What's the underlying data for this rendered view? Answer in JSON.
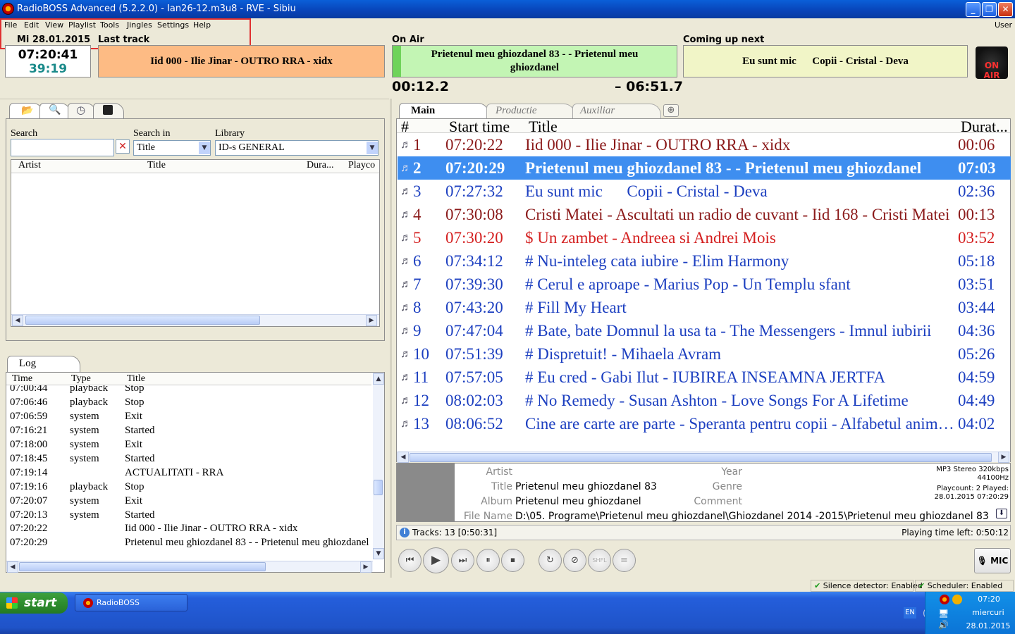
{
  "window": {
    "title": "RadioBOSS Advanced (5.2.2.0) - Ian26-12.m3u8 - RVE - Sibiu",
    "min": "_",
    "max": "❐",
    "close": "✕"
  },
  "menu": [
    "File",
    "Edit",
    "View",
    "Playlist",
    "Tools",
    "Jingles",
    "Settings",
    "Help"
  ],
  "menu_user": "User",
  "clock": {
    "date": "Mi 28.01.2015",
    "time": "07:20:41",
    "remaining": "39:19"
  },
  "last_track": {
    "label": "Last track",
    "text": "Iid 000 - Ilie Jinar - OUTRO RRA - xidx",
    "color": "#fdbb84"
  },
  "on_air": {
    "label": "On Air",
    "text": "Prietenul meu ghiozdanel 83 -  - Prietenul meu ghiozdanel",
    "elapsed": "00:12.2",
    "remaining": "– 06:51.7",
    "color": "#c3f5b4",
    "progress": 0.03
  },
  "coming_next": {
    "label": "Coming up next",
    "text": "Eu sunt mic      Copii - Cristal - Deva",
    "color": "#f1f5c7"
  },
  "onair_logo": {
    "text": "ON AIR"
  },
  "search": {
    "search_label": "Search",
    "searchin_label": "Search in",
    "searchin_value": "Title",
    "library_label": "Library",
    "library_value": "ID-s GENERAL",
    "columns": [
      "Artist",
      "Title",
      "Dura...",
      "Playco"
    ]
  },
  "log": {
    "tab": "Log",
    "columns": [
      "Time",
      "Type",
      "Title"
    ],
    "rows": [
      [
        "07:00:44",
        "playback",
        "Stop"
      ],
      [
        "07:06:46",
        "playback",
        "Stop"
      ],
      [
        "07:06:59",
        "system",
        "Exit"
      ],
      [
        "07:16:21",
        "system",
        "Started"
      ],
      [
        "07:18:00",
        "system",
        "Exit"
      ],
      [
        "07:18:45",
        "system",
        "Started"
      ],
      [
        "07:19:14",
        "",
        "ACTUALITATI - RRA"
      ],
      [
        "07:19:16",
        "playback",
        "Stop"
      ],
      [
        "07:20:07",
        "system",
        "Exit"
      ],
      [
        "07:20:13",
        "system",
        "Started"
      ],
      [
        "07:20:22",
        "",
        "Iid 000 - Ilie Jinar - OUTRO RRA - xidx"
      ],
      [
        "07:20:29",
        "",
        "Prietenul meu ghiozdanel 83 -  - Prietenul meu ghiozdanel"
      ]
    ]
  },
  "playlist_tabs": [
    "Main",
    "Productie",
    "Auxiliar"
  ],
  "playlist": {
    "columns": [
      "#",
      "Start time",
      "Title",
      "Durat..."
    ],
    "rows": [
      {
        "n": "1",
        "start": "07:20:22",
        "title": "Iid 000 - Ilie Jinar - OUTRO RRA - xidx",
        "dur": "00:06",
        "color": "#8b1a1a"
      },
      {
        "n": "2",
        "start": "07:20:29",
        "title": "Prietenul meu ghiozdanel 83 -  - Prietenul meu ghiozdanel",
        "dur": "07:03",
        "color": "#ffffff"
      },
      {
        "n": "3",
        "start": "07:27:32",
        "title": "Eu sunt mic      Copii - Cristal - Deva",
        "dur": "02:36",
        "color": "#1c3fc0"
      },
      {
        "n": "4",
        "start": "07:30:08",
        "title": "Cristi Matei - Ascultati un radio de cuvant - Iid 168 - Cristi Matei",
        "dur": "00:13",
        "color": "#8b1a1a"
      },
      {
        "n": "5",
        "start": "07:30:20",
        "title": "$ Un zambet - Andreea si Andrei Mois",
        "dur": "03:52",
        "color": "#d42020"
      },
      {
        "n": "6",
        "start": "07:34:12",
        "title": "# Nu-inteleg cata iubire - Elim Harmony",
        "dur": "05:18",
        "color": "#1c3fc0"
      },
      {
        "n": "7",
        "start": "07:39:30",
        "title": "# Cerul e aproape - Marius Pop - Un Templu sfant",
        "dur": "03:51",
        "color": "#1c3fc0"
      },
      {
        "n": "8",
        "start": "07:43:20",
        "title": "# Fill My Heart",
        "dur": "03:44",
        "color": "#1c3fc0"
      },
      {
        "n": "9",
        "start": "07:47:04",
        "title": "# Bate, bate Domnul la usa ta - The Messengers - Imnul iubirii",
        "dur": "04:36",
        "color": "#1c3fc0"
      },
      {
        "n": "10",
        "start": "07:51:39",
        "title": "# Dispretuit! - Mihaela Avram",
        "dur": "05:26",
        "color": "#1c3fc0"
      },
      {
        "n": "11",
        "start": "07:57:05",
        "title": "# Eu cred - Gabi Ilut - IUBIREA INSEAMNA JERTFA",
        "dur": "04:59",
        "color": "#1c3fc0"
      },
      {
        "n": "12",
        "start": "08:02:03",
        "title": "# No Remedy - Susan Ashton - Love Songs For A Lifetime",
        "dur": "04:49",
        "color": "#1c3fc0"
      },
      {
        "n": "13",
        "start": "08:06:52",
        "title": "Cine are carte are parte - Speranta pentru copii - Alfabetul animalelor",
        "dur": "04:02",
        "color": "#1c3fc0"
      }
    ]
  },
  "track_info": {
    "artist_label": "Artist",
    "title_label": "Title",
    "album_label": "Album",
    "filename_label": "File Name",
    "year_label": "Year",
    "genre_label": "Genre",
    "comment_label": "Comment",
    "title": "Prietenul meu ghiozdanel 83",
    "album": "Prietenul meu ghiozdanel",
    "filename": "D:\\05. Programe\\Prietenul meu ghiozdanel\\Ghiozdanel 2014 -2015\\Prietenul meu ghiozdanel 83",
    "format": "MP3 Stereo 320kbps",
    "rate": "44100Hz",
    "playcount": "Playcount: 2  Played:",
    "played": "28.01.2015 07:20:29"
  },
  "status": {
    "tracks": "Tracks: 13 [0:50:31]",
    "time_left": "Playing time left: 0:50:12"
  },
  "mic": "MIC",
  "bottom_status": {
    "silence": "Silence detector: Enabled",
    "scheduler": "Scheduler: Enabled"
  },
  "taskbar": {
    "start": "start",
    "app": "RadioBOSS",
    "lang": "EN",
    "time": "07:20",
    "day": "miercuri",
    "date": "28.01.2015"
  }
}
